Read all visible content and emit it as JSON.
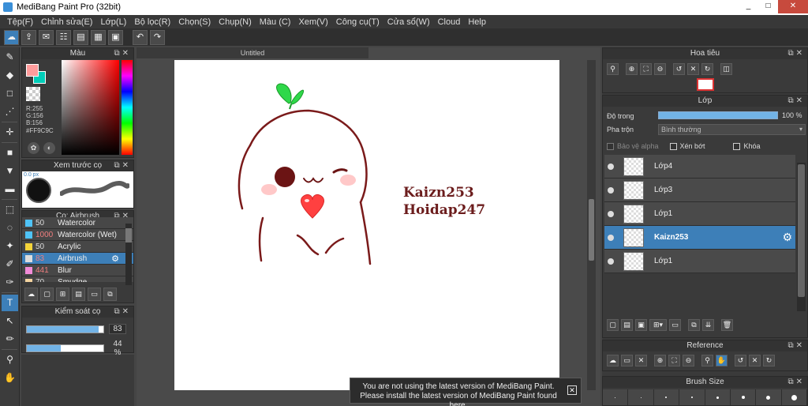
{
  "window": {
    "title": "MediBang Paint Pro (32bit)",
    "min": "_",
    "max": "□",
    "close": "✕"
  },
  "menu": [
    "Tệp(F)",
    "Chỉnh sửa(E)",
    "Lớp(L)",
    "Bộ lọc(R)",
    "Chọn(S)",
    "Chụp(N)",
    "Màu (C)",
    "Xem(V)",
    "Công cụ(T)",
    "Cửa sổ(W)",
    "Cloud",
    "Help"
  ],
  "color_panel": {
    "title": "Màu",
    "foreground": "#FF9C9C",
    "background": "#00CDB8",
    "r": "R:255",
    "g": "G:156",
    "b": "B:156",
    "hex": "#FF9C9C"
  },
  "brush_preview": {
    "title": "Xem trước cọ",
    "size": "0.0 px"
  },
  "brush_panel": {
    "title": "Cọ: Airbrush",
    "items": [
      {
        "size": "50",
        "name": "Watercolor",
        "color": "#4fc3f7",
        "size_red": false,
        "active": false
      },
      {
        "size": "1000",
        "name": "Watercolor (Wet)",
        "color": "#4fc3f7",
        "size_red": true,
        "active": false
      },
      {
        "size": "50",
        "name": "Acrylic",
        "color": "#f4d43a",
        "size_red": false,
        "active": false
      },
      {
        "size": "83",
        "name": "Airbrush",
        "color": "#dddddd",
        "size_red": true,
        "active": true
      },
      {
        "size": "441",
        "name": "Blur",
        "color": "#f28bd8",
        "size_red": true,
        "active": false
      },
      {
        "size": "70",
        "name": "Smudge",
        "color": "#f4d4a0",
        "size_red": false,
        "active": false
      }
    ]
  },
  "brush_control": {
    "title": "Kiểm soát cọ",
    "size_value": "83",
    "size_fill": 0.94,
    "opacity_value": "44 %",
    "opacity_fill": 0.44
  },
  "document": {
    "tab": "Untitled",
    "text_line1": "Kaizn253",
    "text_line2": "Hoidap247"
  },
  "notification": {
    "line1": "You are not using the latest version of MediBang Paint.",
    "line2": "Please install the latest version of MediBang Paint found here.",
    "close": "✕"
  },
  "navigator": {
    "title": "Hoa tiêu"
  },
  "layer_panel": {
    "title": "Lớp",
    "opacity_label": "Độ trong",
    "opacity_value": "100 %",
    "blend_label": "Pha trộn",
    "blend_value": "Bình thường",
    "protect_alpha": "Bảo vệ alpha",
    "clipping": "Xén bớt",
    "lock": "Khóa",
    "layers": [
      {
        "name": "Lớp4",
        "active": false
      },
      {
        "name": "Lớp3",
        "active": false
      },
      {
        "name": "Lớp1",
        "active": false
      },
      {
        "name": "Kaizn253",
        "active": true
      },
      {
        "name": "Lớp1",
        "active": false
      }
    ]
  },
  "reference_panel": {
    "title": "Reference"
  },
  "brush_size_panel": {
    "title": "Brush Size"
  },
  "colors": {
    "accent": "#3d7fb8",
    "panel": "#3a3a3a",
    "dark_red": "#6b1c1c",
    "leaf_green": "#2fd84a"
  }
}
